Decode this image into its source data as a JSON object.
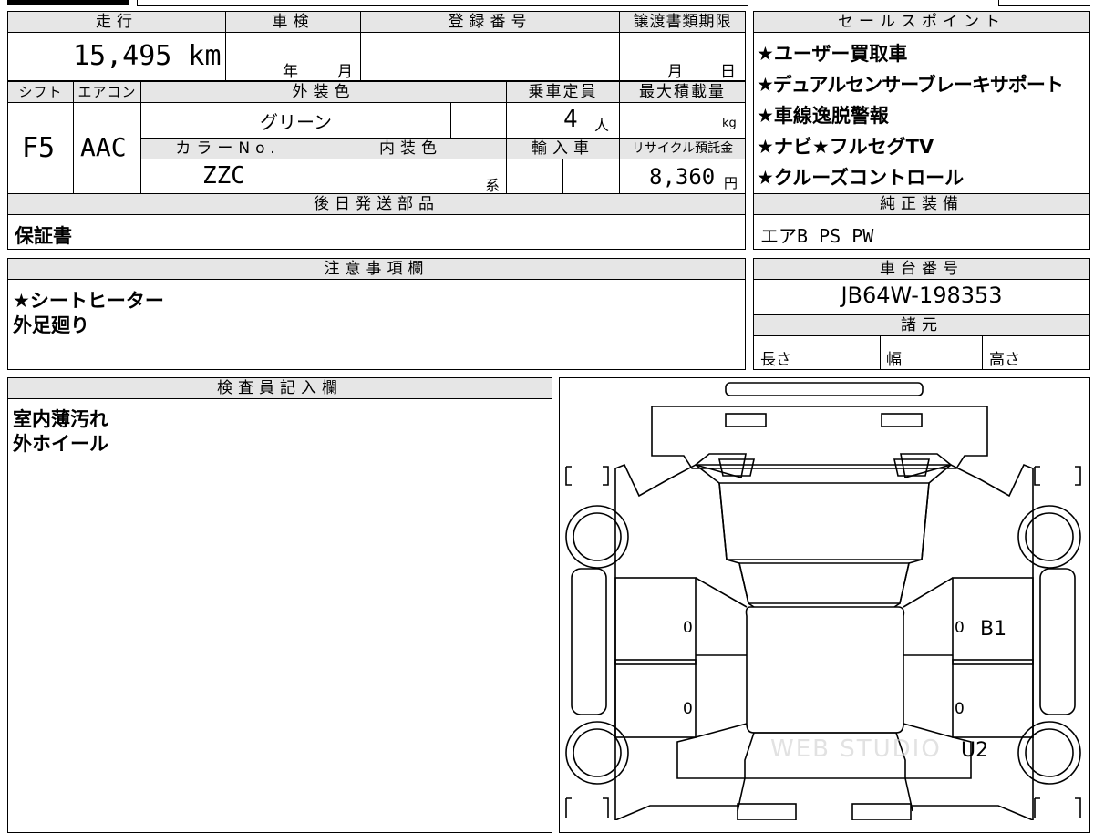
{
  "top_table": {
    "headers": {
      "mileage": "走行",
      "inspection": "車検",
      "registration_no": "登録番号",
      "transfer_deadline": "譲渡書類期限",
      "shift": "シフト",
      "aircon": "エアコン",
      "exterior_color": "外装色",
      "capacity": "乗車定員",
      "max_load": "最大積載量",
      "color_no": "カラーNo.",
      "interior_color": "内装色",
      "import": "輸入車",
      "recycle_fee": "リサイクル預託金",
      "later_parts": "後日発送部品"
    },
    "values": {
      "mileage": "15,495 km",
      "inspection_year_unit": "年",
      "inspection_month_unit": "月",
      "deadline_month_unit": "月",
      "deadline_day_unit": "日",
      "shift": "F5",
      "aircon": "AAC",
      "exterior_color": "グリーン",
      "capacity": "4",
      "capacity_unit": "人",
      "max_load_unit": "kg",
      "color_no": "ZZC",
      "interior_unit": "系",
      "recycle_fee": "8,360",
      "recycle_fee_unit": "円",
      "later_parts": "保証書"
    }
  },
  "sales_points": {
    "header": "セールスポイント",
    "items": [
      "★ユーザー買取車",
      "★デュアルセンサーブレーキサポート",
      "★車線逸脱警報",
      "★ナビ★フルセグTV",
      "★クルーズコントロール"
    ]
  },
  "standard_equipment": {
    "header": "純正装備",
    "value": "エアB PS PW"
  },
  "notes": {
    "header": "注意事項欄",
    "lines": [
      "★シートヒーター",
      "外足廻り"
    ]
  },
  "chassis": {
    "header": "車台番号",
    "value": "JB64W-198353"
  },
  "specs": {
    "header": "諸元",
    "length": "長さ",
    "width": "幅",
    "height": "高さ"
  },
  "inspector": {
    "header": "検査員記入欄",
    "lines": [
      "室内薄汚れ",
      "外ホイール"
    ]
  },
  "diagram": {
    "marks": {
      "left_front_door": "0",
      "left_rear_door": "0",
      "right_front_door": "0",
      "right_front_code": "B1",
      "right_rear_door": "0",
      "right_rear_code": "U2"
    },
    "watermark": "WEB STUDIO"
  }
}
